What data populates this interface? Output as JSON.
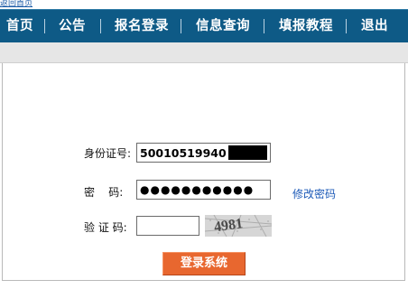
{
  "top_link": {
    "text": "返回首页"
  },
  "nav": {
    "items": [
      {
        "label": "首页"
      },
      {
        "label": "公告"
      },
      {
        "label": "报名登录"
      },
      {
        "label": "信息查询"
      },
      {
        "label": "填报教程"
      },
      {
        "label": "退出"
      }
    ]
  },
  "form": {
    "id_label": "身份证号:",
    "id_value_visible": "50010519940",
    "password_label": "密    码:",
    "password_mask": "●●●●●●●●●●●",
    "change_password_link": "修改密码",
    "captcha_label": "验 证 码:",
    "captcha_value": "",
    "captcha_image_text": "4981",
    "submit_label": "登录系统"
  },
  "colors": {
    "nav_bg": "#0e5a86",
    "button_bg": "#e8672f",
    "link": "#1e5bb8"
  },
  "icons": {
    "redaction": "black-redaction-box",
    "captcha": "captcha-image"
  }
}
